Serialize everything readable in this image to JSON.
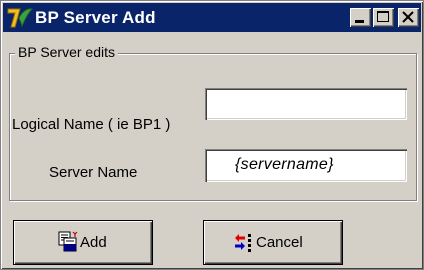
{
  "window": {
    "title": "BP Server Add",
    "icon": "app-logo-icon",
    "controls": [
      "minimize-icon",
      "maximize-icon",
      "close-icon"
    ],
    "titlebar_color": "#0a246a"
  },
  "group": {
    "legend": "BP Server edits"
  },
  "fields": {
    "logical_name": {
      "label": "Logical Name ( ie BP1 )",
      "value": ""
    },
    "server_name": {
      "label": "Server Name",
      "value": "{servername}"
    }
  },
  "buttons": {
    "add": {
      "label": "Add",
      "icon": "add-record-icon"
    },
    "cancel": {
      "label": "Cancel",
      "icon": "cancel-icon"
    }
  }
}
